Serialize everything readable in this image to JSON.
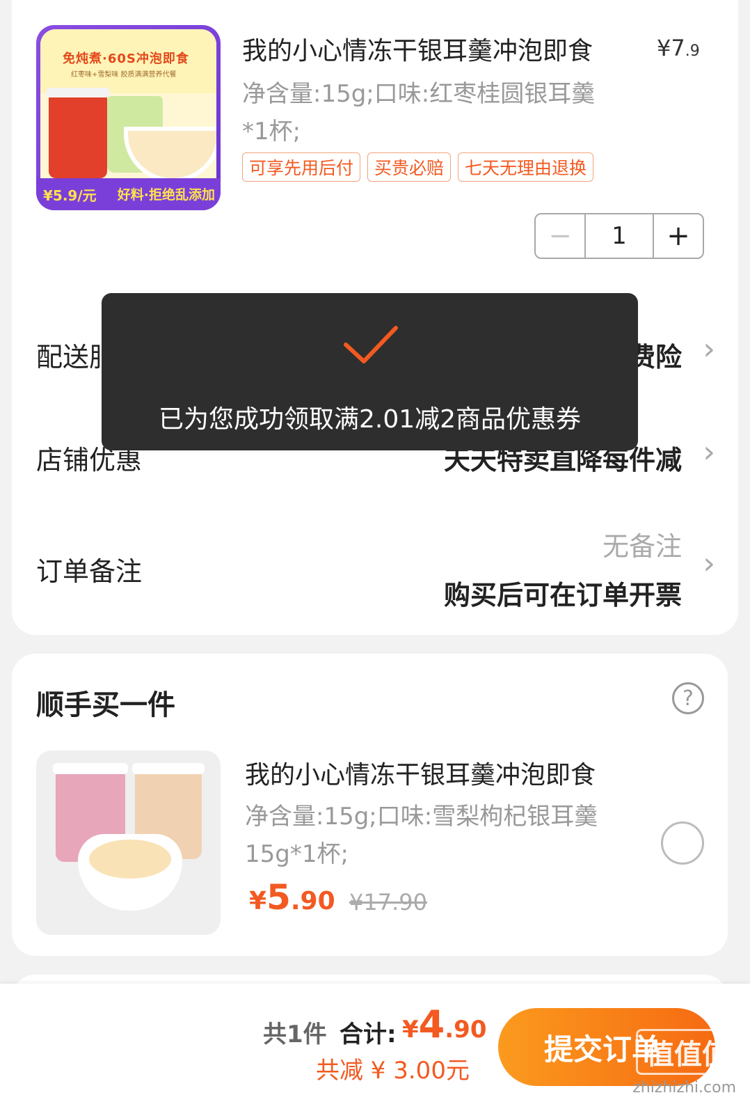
{
  "item": {
    "thumb_headline": "免炖煮·60S冲泡即食",
    "thumb_sub": "红枣味+雪梨味 胶质满满营养代餐",
    "thumb_price": "¥5.9/元",
    "thumb_slogan": "好料·拒绝乱添加",
    "title": "我的小心情冻干银耳羹冲泡即食",
    "price_int": "¥7",
    "price_dec": ".9",
    "spec": "净含量:15g;口味:红枣桂圆银耳羹*1杯;",
    "tags": [
      "可享先用后付",
      "买贵必赔",
      "七天无理由退换"
    ],
    "quantity": "1",
    "minus": "−",
    "plus": "+"
  },
  "rows": {
    "delivery_label": "配送服务",
    "delivery_value": "快递 免邮 送运费险",
    "shop_label": "店铺优惠",
    "shop_value": "天天特卖直降每件减",
    "remark_label": "订单备注",
    "remark_empty": "无备注",
    "remark_value": "购买后可在订单开票",
    "chevron": "›"
  },
  "toast": {
    "message": "已为您成功领取满2.01减2商品优惠券"
  },
  "addon": {
    "section_title": "顺手买一件",
    "help": "?",
    "title": "我的小心情冻干银耳羹冲泡即食",
    "spec": "净含量:15g;口味:雪梨枸杞银耳羹15g*1杯;",
    "price_cur": "¥",
    "price_int": "5",
    "price_dec": ".90",
    "price_old": "¥17.90"
  },
  "footer": {
    "count": "共1件",
    "total_label": "合计:",
    "total_cur": "¥",
    "total_int": "4",
    "total_dec": ".90",
    "discount": "共减 ¥ 3.00元",
    "submit": "提交订单",
    "watermark": "值值值",
    "watermark_site": "zhizhizhi.com"
  },
  "colors": {
    "accent": "#f25a21",
    "button_start": "#fb9a1e",
    "button_end": "#f66a12",
    "toast_bg": "#2e2e2e"
  }
}
